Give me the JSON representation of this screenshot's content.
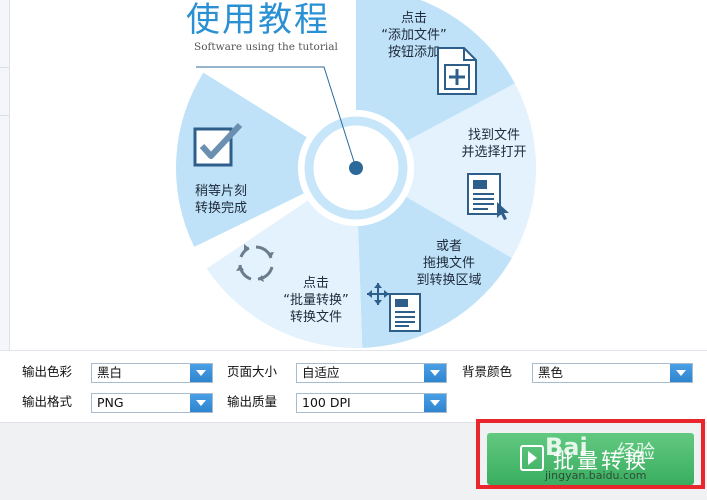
{
  "header": {
    "title": "使用教程",
    "subtitle": "Software using the tutorial"
  },
  "wheel": {
    "steps": [
      {
        "lines": [
          "点击",
          "“添加文件”",
          "按钮添加"
        ],
        "icon": "add-file-icon"
      },
      {
        "lines": [
          "找到文件",
          "并选择打开"
        ],
        "icon": "open-file-icon"
      },
      {
        "lines": [
          "或者",
          "拖拽文件",
          "到转换区域"
        ],
        "icon": "drag-file-icon"
      },
      {
        "lines": [
          "点击",
          "“批量转换”",
          "转换文件"
        ],
        "icon": "refresh-icon"
      },
      {
        "lines": [
          "稍等片刻",
          "转换完成"
        ],
        "icon": "checkbox-icon"
      }
    ],
    "colors": {
      "dark": "#bfe2f8",
      "light": "#e3f2fc",
      "accent": "#2a90d4",
      "needle": "#2d6a99"
    }
  },
  "settings": {
    "output_color_label": "输出色彩",
    "output_color_value": "黑白",
    "page_size_label": "页面大小",
    "page_size_value": "自适应",
    "bg_color_label": "背景颜色",
    "bg_color_value": "黑色",
    "output_format_label": "输出格式",
    "output_format_value": "PNG",
    "output_quality_label": "输出质量",
    "output_quality_value": "100 DPI"
  },
  "footer": {
    "start_label": "批量转换",
    "highlight_color": "#e8262b",
    "button_color": "#3aae60"
  },
  "watermark": {
    "brand": "Bai",
    "brand_cn": "经验",
    "url": "jingyan.baidu.com"
  }
}
